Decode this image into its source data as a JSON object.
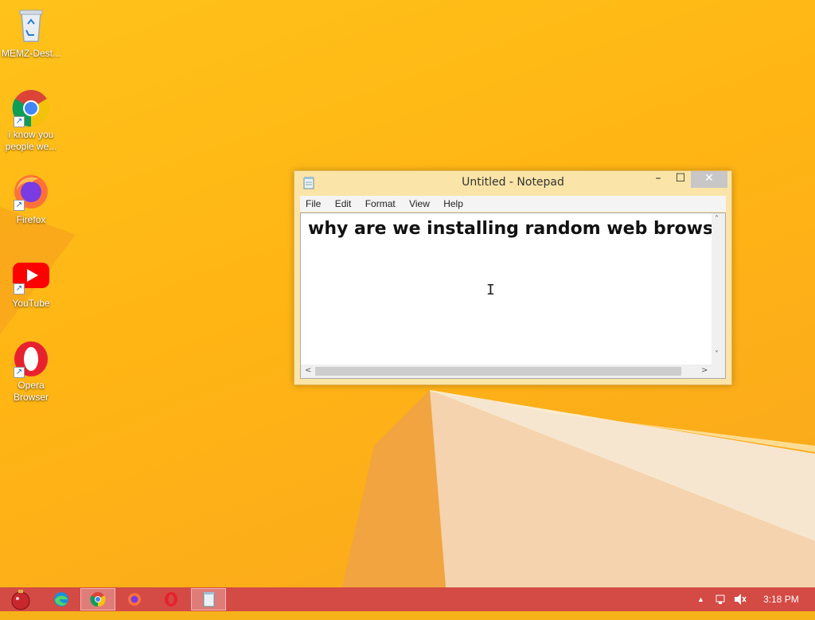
{
  "desktop": {
    "icons": [
      {
        "label": "MEMZ-Dest...",
        "icon": "recycle-bin-icon"
      },
      {
        "label_line1": "i know you",
        "label_line2": "people we...",
        "icon": "chrome-icon"
      },
      {
        "label": "Firefox",
        "icon": "firefox-icon"
      },
      {
        "label": "YouTube",
        "icon": "youtube-icon"
      },
      {
        "label_line1": "Opera",
        "label_line2": "Browser",
        "icon": "opera-icon"
      }
    ]
  },
  "notepad": {
    "title": "Untitled - Notepad",
    "menu": [
      "File",
      "Edit",
      "Format",
      "View",
      "Help"
    ],
    "content": "why are we installing random web browsers",
    "buttons": {
      "minimize": "–",
      "maximize": "☐",
      "close": "✕"
    }
  },
  "taskbar": {
    "apps": [
      "start-icon",
      "edge-icon",
      "chrome-icon",
      "firefox-icon",
      "opera-icon",
      "notepad-icon"
    ],
    "active_app": "chrome",
    "tray": {
      "overflow": "▲",
      "clock": "3:18 PM"
    }
  },
  "colors": {
    "wallpaper": "#ffb514",
    "taskbar": "#d44a44",
    "window_frame": "#fbe4a7"
  }
}
